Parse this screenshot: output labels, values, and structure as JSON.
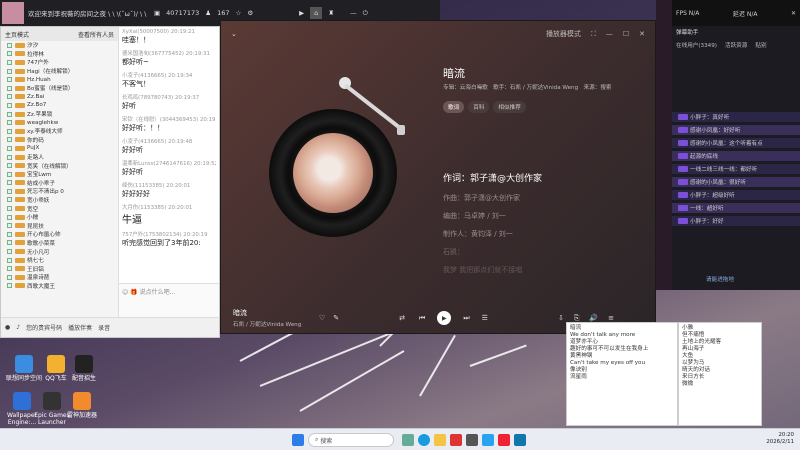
{
  "topbar": {
    "title": "欢迎来到李祝薇的房间之夜 \\ \\ \\(ˇωˇ)/ \\ \\",
    "views": "40717173",
    "fans": "167"
  },
  "chat": {
    "ul_header_left": "主页模式",
    "ul_header_right": "查看所有人员",
    "users": [
      "汐汐",
      "拉得林",
      "747户外",
      "Hagi（在线解锁）",
      "Hz.Huah",
      "Bo蜜蜜（线是锁）",
      "Zz.Bai",
      "Zz.Bo7",
      "Zz.苹果锁",
      "weaglehkw",
      "xy.李泰线大师",
      "你的码",
      "PuJX",
      "走路人",
      "宽笑（在线解锁）",
      "宝宝Lwm",
      "结成小乖子",
      "死忘不清出p 0",
      "宽小乖妖",
      "宽空",
      "小糯",
      "昆昆扶",
      "开心布凰心帅",
      "歌歌小菜菜",
      "无小凡可",
      "桃七七",
      "王旧铝",
      "温泉诗琵",
      "西歌大魔王"
    ],
    "messages": [
      {
        "who": "XyXai(50007500) 20:19:21",
        "text": "哇塞！！",
        "big": false
      },
      {
        "who": "德米国浩旬(367775452) 20:19:31",
        "text": "都好听~",
        "big": false
      },
      {
        "who": "小凌子(4136665) 20:19:34",
        "text": "不客气！",
        "big": false
      },
      {
        "who": "长鸡鸡(789780743) 20:19:37",
        "text": "好听",
        "big": false
      },
      {
        "who": "宋钦（在线慰）(3044369453) 20:19:44",
        "text": "好好听：！！",
        "big": false
      },
      {
        "who": "小凌子(4136665) 20:19:48",
        "text": "好好听",
        "big": false
      },
      {
        "who": "温柔新Lunss(2746147616) 20:19:52",
        "text": "好好听",
        "big": false
      },
      {
        "who": "绛伤(11153385) 20:20:01",
        "text": "好好好好",
        "big": false
      },
      {
        "who": "大月伤(1153385) 20:20:01",
        "text": "牛逼",
        "big": true
      },
      {
        "who": "757户外(1753802134) 20:20:19",
        "text": "听完感觉回到了3年前20:",
        "big": false
      }
    ],
    "input_placeholder": "说点什么吧...",
    "bar_items": [
      "您的贵宾号码",
      "播放伴奏",
      "录音"
    ]
  },
  "player": {
    "header_mode": "播放器模式",
    "song": "暗流",
    "album_label": "专辑：云海白噪歌",
    "singer_label": "歌手：石凯 / 万妮达Vinida Weng",
    "source_label": "来源：搜索",
    "tabs": [
      "歌词",
      "百科",
      "相似推荐"
    ],
    "lyrics": [
      "作词：郭子潇@大创作家",
      "作曲：郭子潇@大创作家",
      "编曲：马卓婷 / 刘一",
      "制作人：黄钧泽 / 刘一",
      "石凯：",
      "我梦 我把那点们就不接唱"
    ],
    "current_line": 0,
    "bottom_title": "暗流",
    "bottom_artist": "石凯 / 万妮达Vinida Weng"
  },
  "rpanel": {
    "title": "弹幕助手",
    "fps": "FPS N/A",
    "delay": "延迟 N/A",
    "online": "在线用户(3349)",
    "tabs": [
      "活跃资源",
      "贴别"
    ],
    "danmaku": [
      "小胖子：真好听",
      "感谢小凤凰：好好听",
      "感谢的小凤凰：这个听着有点",
      "起源的底线",
      "一线二线三线一线：都好听",
      "感谢的小凤凰：很好听",
      "小胖子：超级好听",
      "一线：超好听",
      "小胖子：好好"
    ],
    "footer": "请能进拖地"
  },
  "note1": {
    "lines": [
      "暗流",
      "We don't talk any more",
      "道梦亦平心",
      "趣好的事可不可以发生在我身上",
      "黄黑神钢",
      "Can't take my eyes off you",
      "像诀别",
      "流星雨"
    ]
  },
  "note2": {
    "lines": [
      "小雅",
      "但不痛悟",
      "土地上的光耀客",
      "再山海子",
      "大鱼",
      "以梦为马",
      "晴天的对话",
      "来日方长",
      "微微"
    ]
  },
  "taskbar": {
    "search": "搜索",
    "time": "20:20",
    "date": "2026/2/11"
  },
  "desktop": {
    "icons": [
      "Wallpaper Engine:...",
      "Epic Games Launcher",
      "雷神加速器",
      "配音招生",
      "QQ飞车",
      "联想同步空间"
    ]
  }
}
